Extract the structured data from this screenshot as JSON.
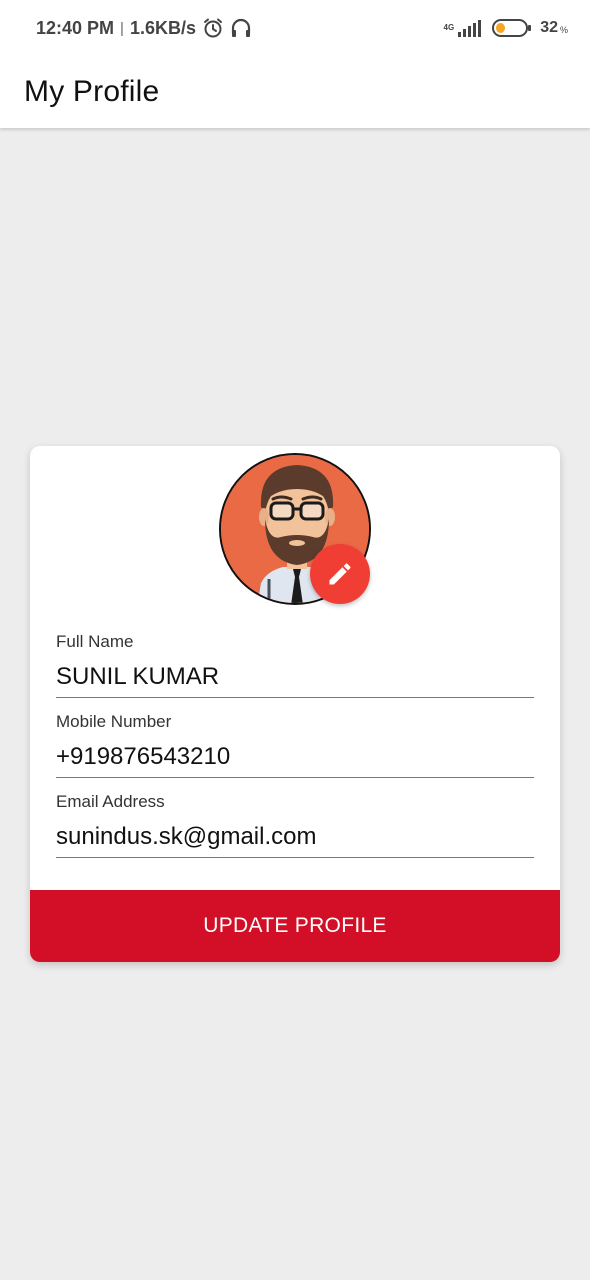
{
  "status_bar": {
    "time": "12:40 PM",
    "separator": "|",
    "net_speed": "1.6KB/s",
    "network_type": "4G",
    "battery_percent": "32",
    "battery_sign": "%",
    "battery_level": 0.32,
    "battery_color": "#f5a623"
  },
  "app_bar": {
    "title": "My Profile"
  },
  "profile": {
    "avatar_bg": "#e96a45",
    "edit_color": "#f03e34",
    "fields": [
      {
        "label": "Full Name",
        "value": "SUNIL KUMAR"
      },
      {
        "label": "Mobile Number",
        "value": "+919876543210"
      },
      {
        "label": "Email Address",
        "value": "sunindus.sk@gmail.com"
      }
    ],
    "update_label": "UPDATE PROFILE",
    "update_color": "#d20f26"
  }
}
